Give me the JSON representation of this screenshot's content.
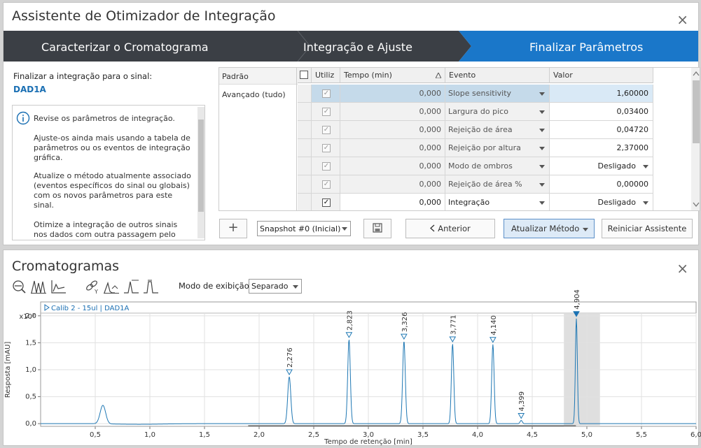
{
  "wizard": {
    "title": "Assistente de Otimizador de Integração",
    "steps": [
      {
        "label": "Caracterizar o Cromatograma"
      },
      {
        "label": "Integração e Ajuste"
      },
      {
        "label": "Finalizar Parâmetros"
      }
    ],
    "signal_prompt": "Finalizar a integração para o sinal:",
    "signal_name": "DAD1A",
    "info": [
      "Revise os parâmetros de integração.",
      "Ajuste-os ainda mais usando a tabela de parâmetros ou os eventos de integração gráfica.",
      "Atualize o método atualmente associado (eventos específicos do sinal ou globais) com os novos parâmetros para este sinal.",
      "Otimize a integração de outros sinais nos dados com outra passagem pelo assistente."
    ],
    "categories": [
      "Padrão",
      "Avançado (tudo)"
    ],
    "columns": {
      "use": "Utiliz",
      "time": "Tempo (min)",
      "event": "Evento",
      "value": "Valor"
    },
    "rows": [
      {
        "checked": true,
        "enabled": false,
        "time": "0,000",
        "event": "Slope sensitivity",
        "value": "1,60000",
        "dropdown": false,
        "selected": true
      },
      {
        "checked": true,
        "enabled": false,
        "time": "0,000",
        "event": "Largura do pico",
        "value": "0,03400",
        "dropdown": false,
        "selected": false
      },
      {
        "checked": true,
        "enabled": false,
        "time": "0,000",
        "event": "Rejeição de área",
        "value": "0,04720",
        "dropdown": false,
        "selected": false
      },
      {
        "checked": true,
        "enabled": false,
        "time": "0,000",
        "event": "Rejeição por altura",
        "value": "2,37000",
        "dropdown": false,
        "selected": false
      },
      {
        "checked": true,
        "enabled": false,
        "time": "0,000",
        "event": "Modo de ombros",
        "value": "Desligado",
        "dropdown": true,
        "selected": false
      },
      {
        "checked": true,
        "enabled": false,
        "time": "0,000",
        "event": "Rejeição de área %",
        "value": "0,00000",
        "dropdown": false,
        "selected": false
      },
      {
        "checked": true,
        "enabled": true,
        "time": "0,000",
        "event": "Integração",
        "value": "Desligado",
        "dropdown": true,
        "selected": false
      }
    ],
    "add_label": "+",
    "snapshot": "Snapshot #0 (Inicial)",
    "prev_label": "Anterior",
    "update_label": "Atualizar Método",
    "restart_label": "Reiniciar Assistente",
    "close_label": "×"
  },
  "chromatograms": {
    "title": "Cromatogramas",
    "close_label": "×",
    "tools": [
      "zoom-out-icon",
      "overlay-icon",
      "stack-icon",
      "link-y-icon",
      "peak-label-icon",
      "baseline-icon",
      "integration-event-icon"
    ],
    "display_mode_label": "Modo de exibição",
    "display_mode": "Separado",
    "colors": {
      "trace": "#1f78b4",
      "peak_label": "#1f78b4",
      "selection": "#dcdcdc",
      "accent": "#1a6fb3"
    }
  },
  "chart_data": {
    "type": "line",
    "title": "Calib 2 - 15ul | DAD1A",
    "xlabel": "Tempo de retenção [min]",
    "ylabel": "Resposta [mAU]",
    "y_multiplier_label": "x10²",
    "xlim": [
      0.0,
      6.0
    ],
    "ylim": [
      -0.05,
      2.05
    ],
    "x_ticks": [
      0.5,
      1.0,
      1.5,
      2.0,
      2.5,
      3.0,
      3.5,
      4.0,
      4.5,
      5.0,
      5.5,
      6.0
    ],
    "x_tick_labels": [
      "0,5",
      "1,0",
      "1,5",
      "2,0",
      "2,5",
      "3,0",
      "3,5",
      "4,0",
      "4,5",
      "5,0",
      "5,5",
      "6,0"
    ],
    "y_ticks": [
      0.0,
      0.5,
      1.0,
      1.5,
      2.0
    ],
    "y_tick_labels": [
      "0,0",
      "0,5",
      "1,0",
      "1,5",
      "2,0"
    ],
    "grid": true,
    "selection_range": [
      4.79,
      5.12
    ],
    "peaks": [
      {
        "rt": 0.57,
        "height": 0.34,
        "width": 0.025,
        "label": ""
      },
      {
        "rt": 2.276,
        "height": 0.87,
        "width": 0.014,
        "label": "2,276"
      },
      {
        "rt": 2.823,
        "height": 1.56,
        "width": 0.012,
        "label": "2,823"
      },
      {
        "rt": 3.326,
        "height": 1.53,
        "width": 0.012,
        "label": "3,326"
      },
      {
        "rt": 3.771,
        "height": 1.48,
        "width": 0.011,
        "label": "3,771"
      },
      {
        "rt": 4.14,
        "height": 1.47,
        "width": 0.011,
        "label": "4,140"
      },
      {
        "rt": 4.399,
        "height": 0.06,
        "width": 0.01,
        "label": "4,399"
      },
      {
        "rt": 4.904,
        "height": 1.95,
        "width": 0.009,
        "label": "4,904"
      }
    ]
  }
}
